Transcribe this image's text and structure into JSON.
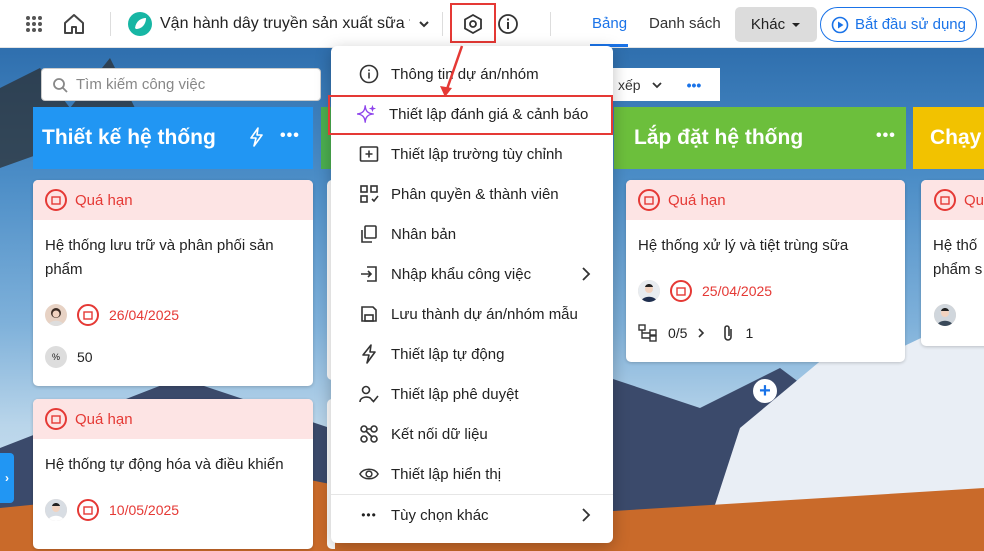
{
  "project": {
    "title": "Vận hành dây truyền sản xuất sữa t..."
  },
  "tabs": [
    {
      "label": "Bảng",
      "active": true
    },
    {
      "label": "Danh sách",
      "active": false
    }
  ],
  "khac_label": "Khác",
  "start_label": "Bắt đầu sử dụng",
  "search": {
    "placeholder": "Tìm kiếm công việc"
  },
  "toolbar": {
    "sort_label": "xếp"
  },
  "columns": [
    {
      "title": "Thiết kế hệ thống",
      "color": "#2196f3",
      "cards": [
        {
          "status": "Quá hạn",
          "title": "Hệ thống lưu trữ và phân phối sản phẩm",
          "date": "26/04/2025",
          "progress": "50"
        },
        {
          "status": "Quá hạn",
          "title": "Hệ thống tự động hóa và điều khiển",
          "date": "10/05/2025"
        }
      ]
    },
    {
      "title": "Lắp đặt hệ thống",
      "color": "#6cbf3c",
      "cards": [
        {
          "status": "Quá hạn",
          "title": "Hệ thống xử lý và tiệt trùng sữa",
          "date": "25/04/2025",
          "subtasks": "0/5",
          "attachments": "1"
        }
      ]
    },
    {
      "title": "Chạy",
      "color": "#f2c200",
      "cards": [
        {
          "status": "Qu",
          "title_line1": "Hệ thố",
          "title_line2": "phẩm s"
        }
      ]
    }
  ],
  "menu": {
    "items": [
      {
        "label": "Thông tin dự án/nhóm",
        "icon": "info-icon"
      },
      {
        "label": "Thiết lập đánh giá & cảnh báo",
        "icon": "sparkle-icon"
      },
      {
        "label": "Thiết lập trường tùy chỉnh",
        "icon": "add-field-icon"
      },
      {
        "label": "Phân quyền & thành viên",
        "icon": "permission-icon"
      },
      {
        "label": "Nhân bản",
        "icon": "duplicate-icon"
      },
      {
        "label": "Nhập khẩu công việc",
        "icon": "import-icon"
      },
      {
        "label": "Lưu thành dự án/nhóm mẫu",
        "icon": "save-icon"
      },
      {
        "label": "Thiết lập tự động",
        "icon": "lightning-icon"
      },
      {
        "label": "Thiết lập phê duyệt",
        "icon": "approval-icon"
      },
      {
        "label": "Kết nối dữ liệu",
        "icon": "connect-icon"
      },
      {
        "label": "Thiết lập hiển thị",
        "icon": "eye-icon"
      }
    ],
    "more_label": "Tùy chọn khác"
  },
  "colors": {
    "accent": "#1a73e8",
    "danger": "#e53935",
    "overdue_bg": "#fde4e4",
    "sparkle": "#8e44ec"
  }
}
